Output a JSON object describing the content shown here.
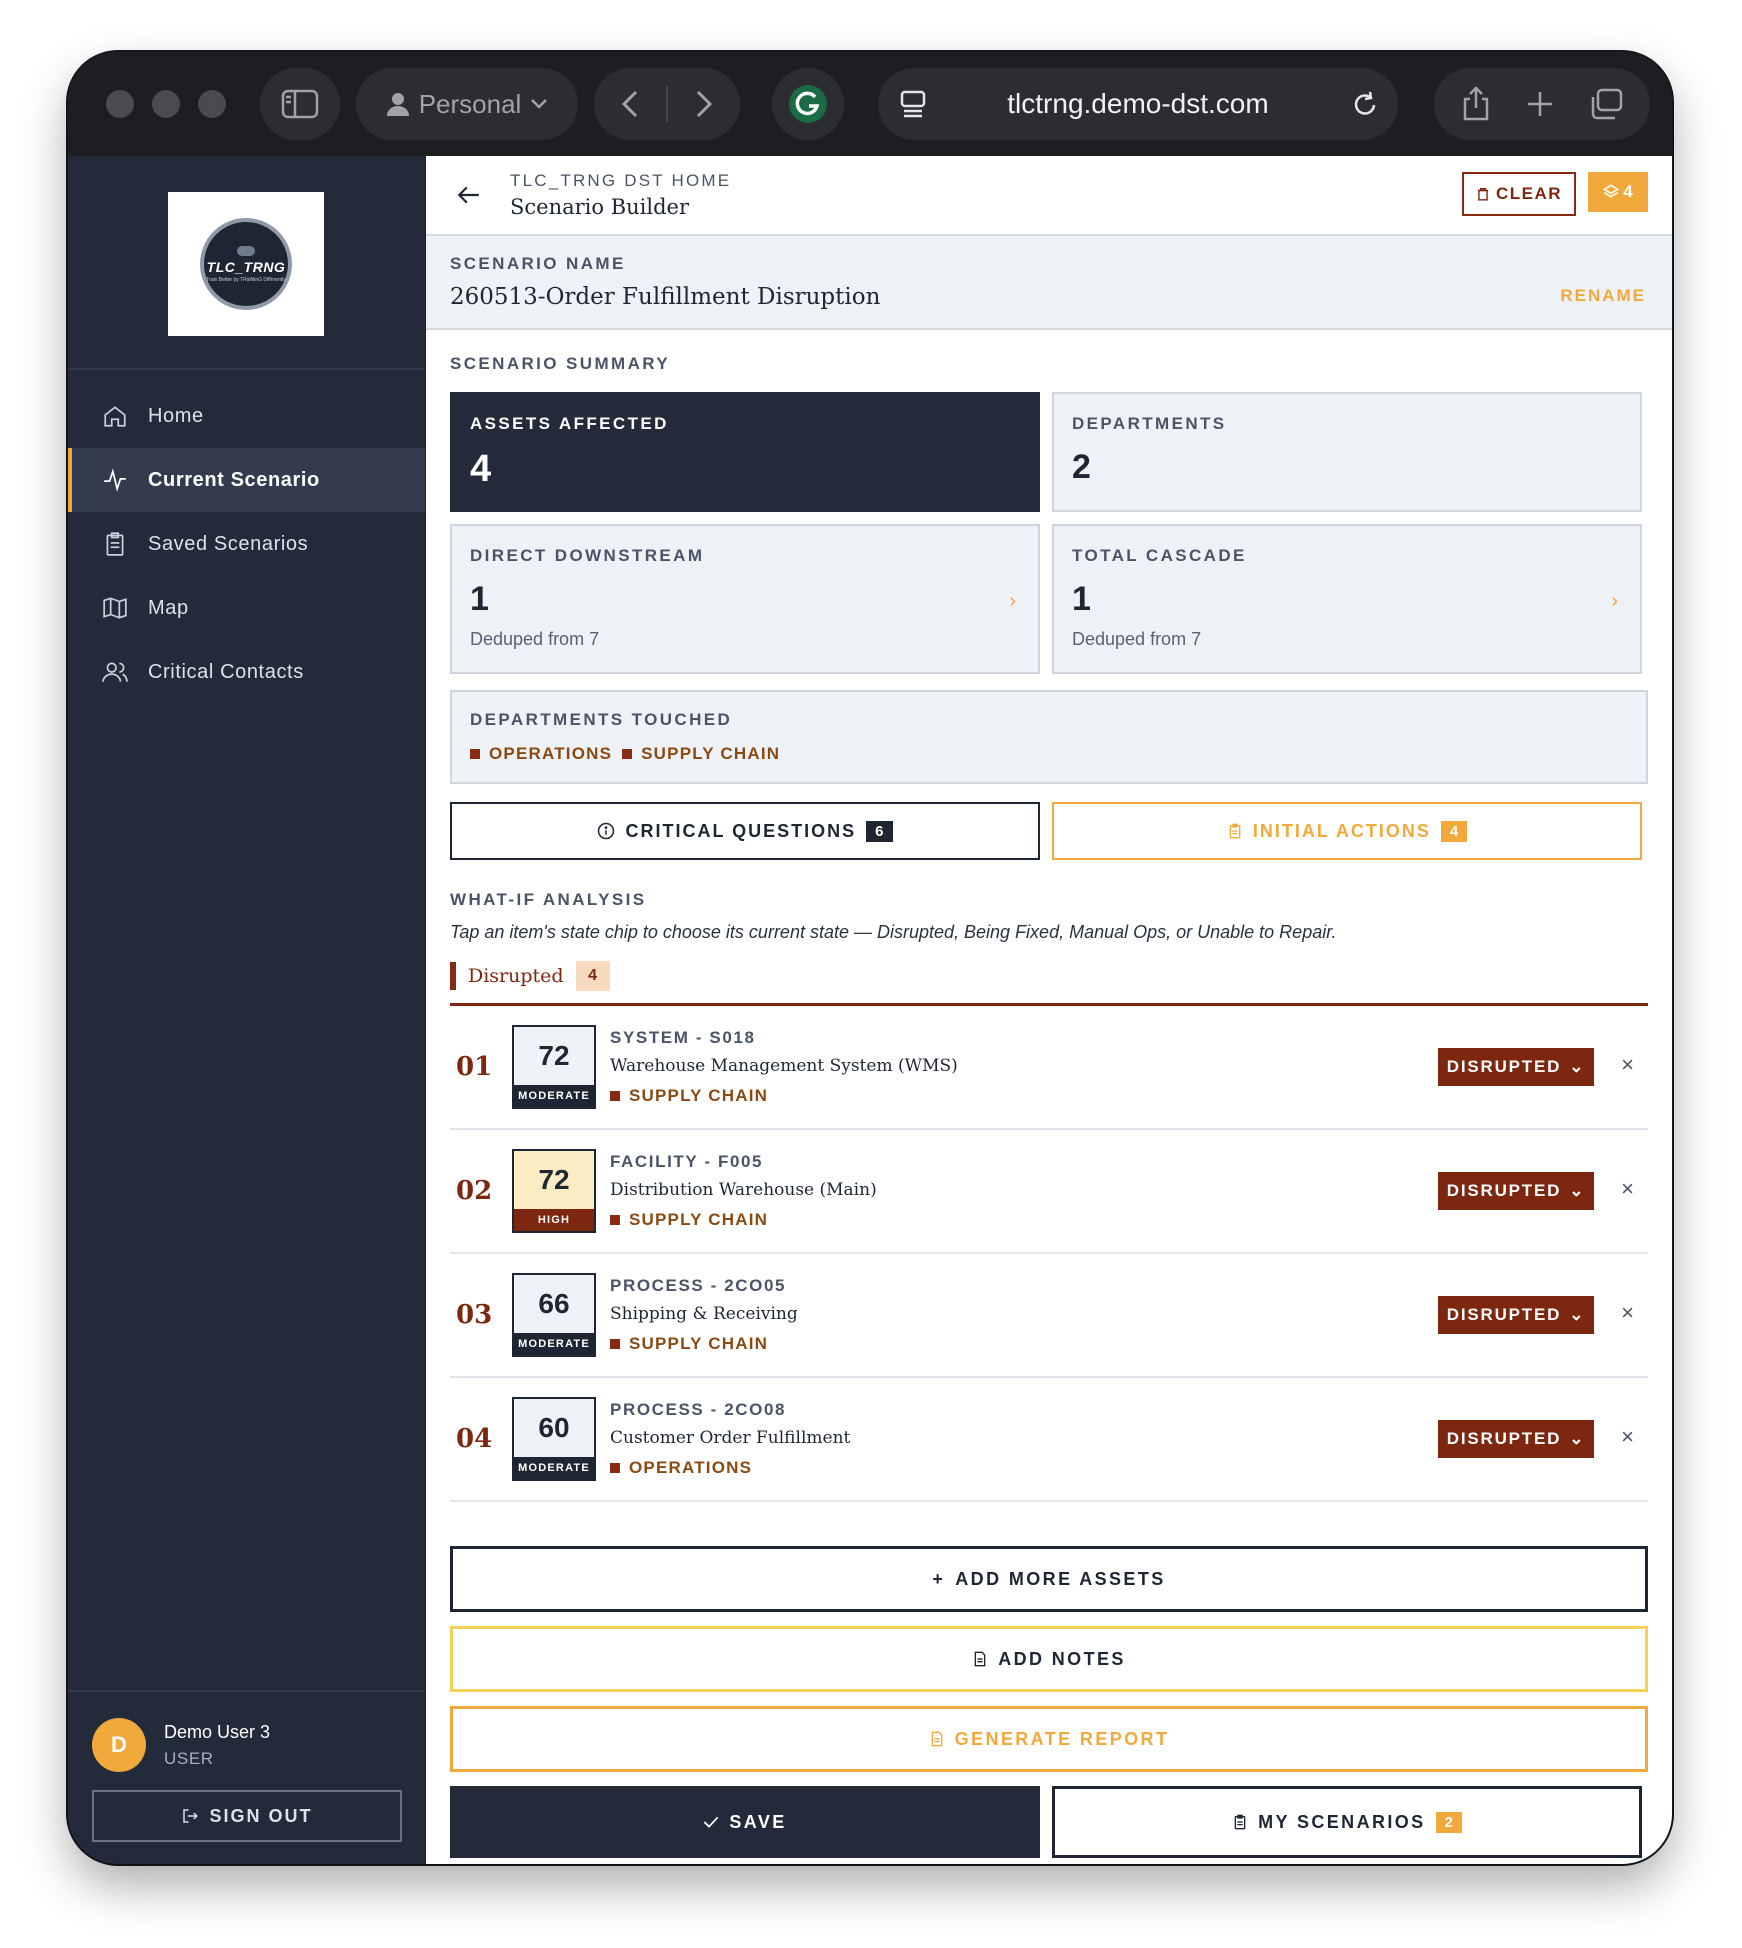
{
  "browser": {
    "profile_label": "Personal",
    "url": "tlctrng.demo-dst.com"
  },
  "sidebar": {
    "logo": {
      "main": "TLC_TRNG",
      "sub": "Train Better by TRaiNinG Differently"
    },
    "items": [
      {
        "label": "Home",
        "icon": "home-icon"
      },
      {
        "label": "Current Scenario",
        "icon": "activity-icon",
        "active": true
      },
      {
        "label": "Saved Scenarios",
        "icon": "clipboard-icon"
      },
      {
        "label": "Map",
        "icon": "map-icon"
      },
      {
        "label": "Critical Contacts",
        "icon": "users-icon"
      }
    ],
    "user": {
      "initial": "D",
      "name": "Demo User 3",
      "role": "USER"
    },
    "signout_label": "SIGN OUT"
  },
  "header": {
    "crumb": "TLC_TRNG DST HOME",
    "title": "Scenario Builder",
    "clear_label": "CLEAR",
    "layers_count": "4"
  },
  "scenario": {
    "name_label": "SCENARIO NAME",
    "name": "260513-Order Fulfillment Disruption",
    "rename_label": "RENAME"
  },
  "summary": {
    "label": "SCENARIO SUMMARY",
    "assets_affected": {
      "label": "ASSETS AFFECTED",
      "value": "4"
    },
    "departments": {
      "label": "DEPARTMENTS",
      "value": "2"
    },
    "direct_downstream": {
      "label": "DIRECT DOWNSTREAM",
      "value": "1",
      "sub": "Deduped from 7"
    },
    "total_cascade": {
      "label": "TOTAL CASCADE",
      "value": "1",
      "sub": "Deduped from 7"
    },
    "departments_touched": {
      "label": "DEPARTMENTS TOUCHED",
      "tags": [
        "OPERATIONS",
        "SUPPLY CHAIN"
      ]
    }
  },
  "actions": {
    "critical_questions": {
      "label": "CRITICAL QUESTIONS",
      "count": "6"
    },
    "initial_actions": {
      "label": "INITIAL ACTIONS",
      "count": "4"
    }
  },
  "whatif": {
    "label": "WHAT-IF ANALYSIS",
    "description": "Tap an item's state chip to choose its current state — Disrupted, Being Fixed, Manual Ops, or Unable to Repair.",
    "group": {
      "title": "Disrupted",
      "count": "4"
    },
    "assets": [
      {
        "num": "01",
        "score": "72",
        "level": "MODERATE",
        "code": "SYSTEM - S018",
        "name": "Warehouse Management System (WMS)",
        "dept": "SUPPLY CHAIN",
        "state": "DISRUPTED"
      },
      {
        "num": "02",
        "score": "72",
        "level": "HIGH",
        "code": "FACILITY - F005",
        "name": "Distribution Warehouse (Main)",
        "dept": "SUPPLY CHAIN",
        "state": "DISRUPTED"
      },
      {
        "num": "03",
        "score": "66",
        "level": "MODERATE",
        "code": "PROCESS - 2CO05",
        "name": "Shipping & Receiving",
        "dept": "SUPPLY CHAIN",
        "state": "DISRUPTED"
      },
      {
        "num": "04",
        "score": "60",
        "level": "MODERATE",
        "code": "PROCESS - 2CO08",
        "name": "Customer Order Fulfillment",
        "dept": "OPERATIONS",
        "state": "DISRUPTED"
      }
    ]
  },
  "footer_buttons": {
    "add_assets": "ADD MORE ASSETS",
    "add_notes": "ADD NOTES",
    "generate_report": "GENERATE REPORT",
    "save": "SAVE",
    "my_scenarios": "MY SCENARIOS",
    "my_scenarios_count": "2"
  },
  "colors": {
    "sidebar_bg": "#232b3a",
    "accent_orange": "#f2a93b",
    "disrupted_brown": "#7d2710",
    "notes_yellow": "#f6cf55"
  }
}
